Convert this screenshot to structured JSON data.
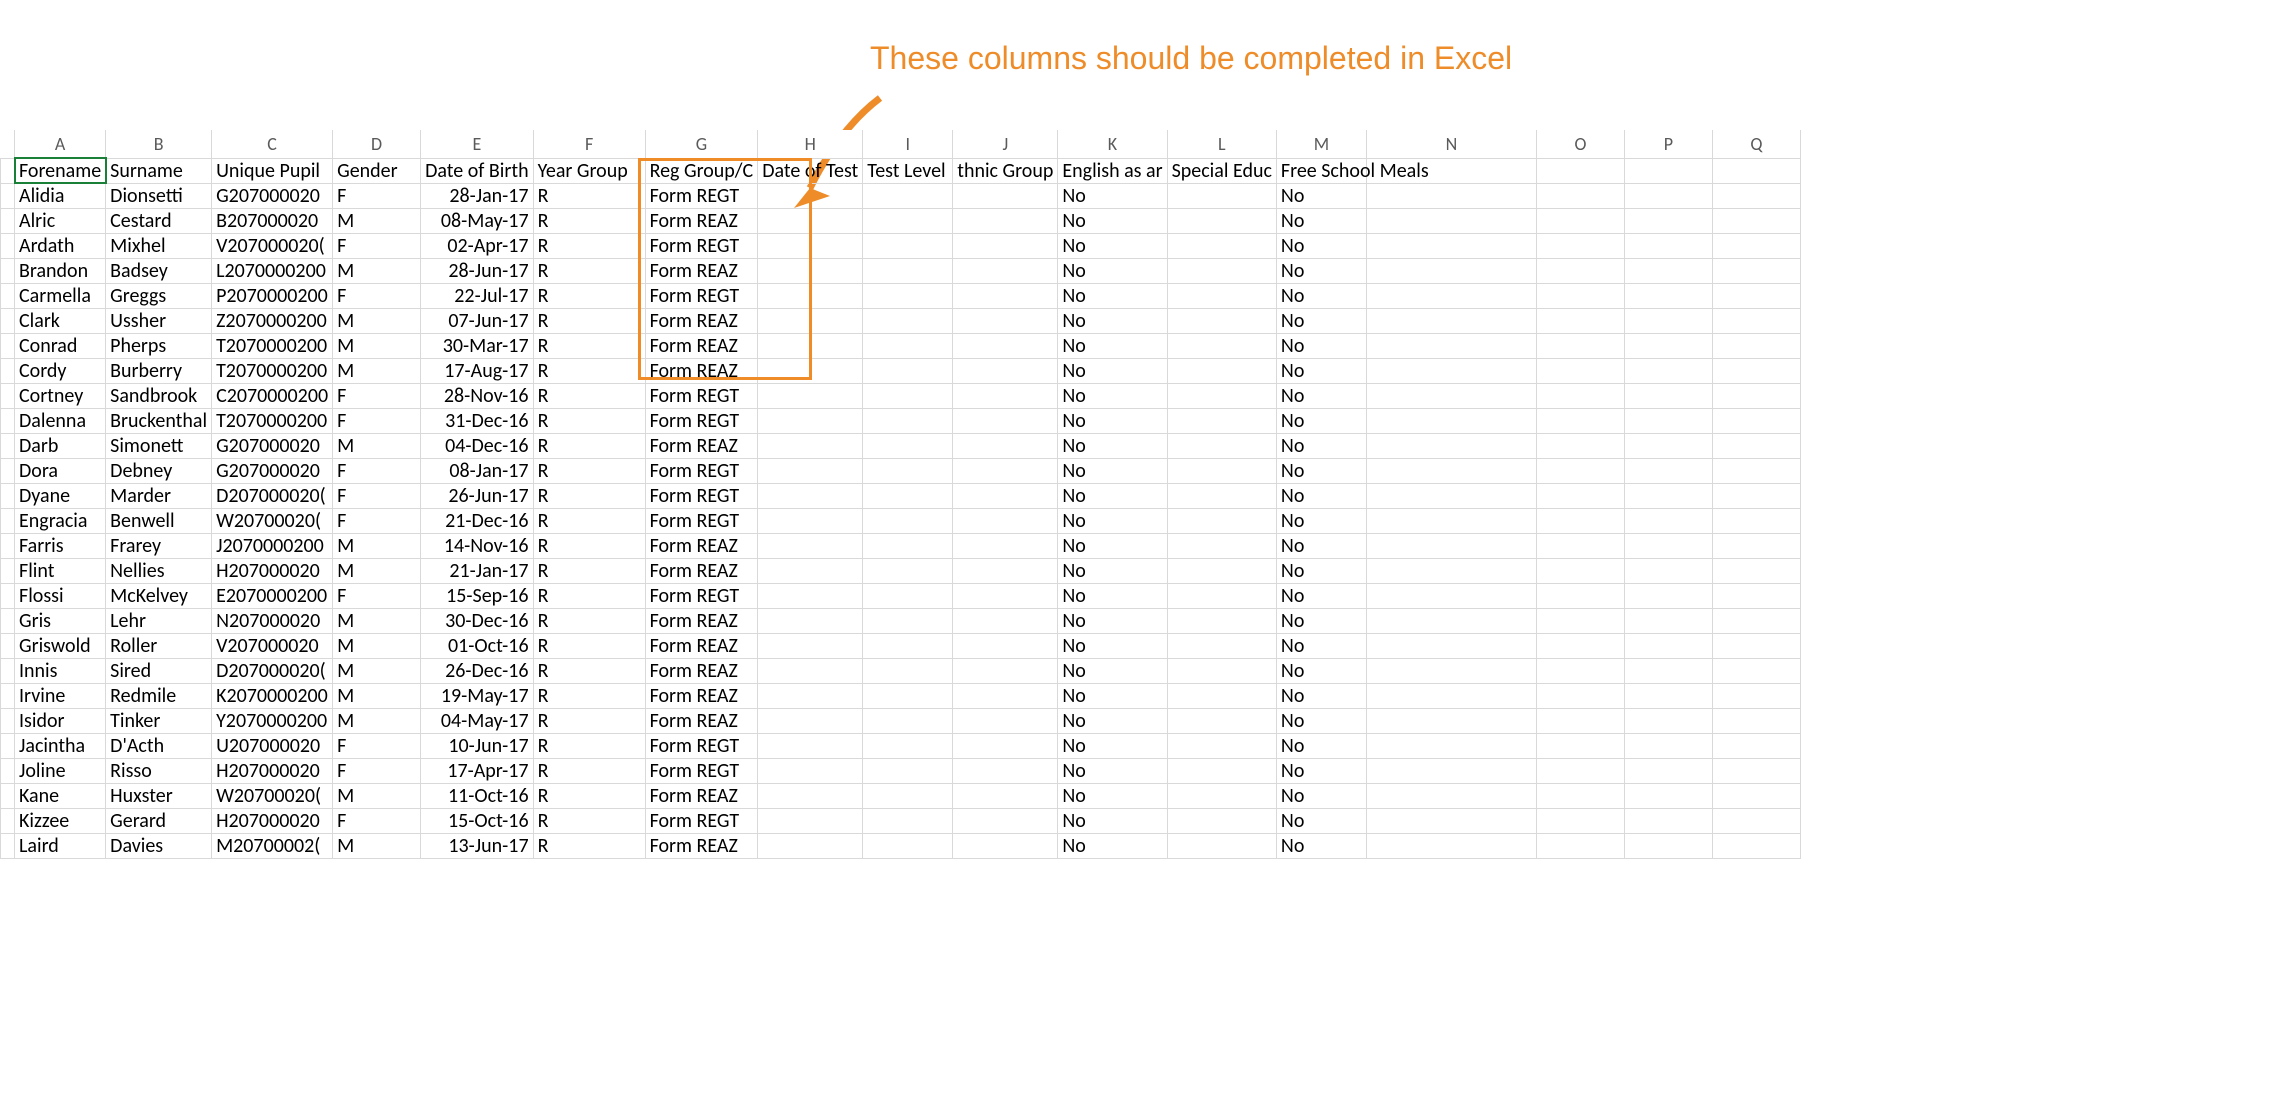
{
  "annotation": "These columns should be completed in Excel",
  "columns_letters": [
    "",
    "A",
    "B",
    "C",
    "D",
    "E",
    "F",
    "G",
    "H",
    "I",
    "J",
    "K",
    "L",
    "M",
    "N",
    "O",
    "P",
    "Q"
  ],
  "headers": [
    "Forename",
    "Surname",
    "Unique Pupil",
    "Gender",
    "Date of Birth",
    "Year Group",
    "Reg Group/C",
    "Date of Test",
    "Test Level",
    "thnic Group",
    "English as ar",
    "Special Educ",
    "Free School Meals"
  ],
  "rows": [
    {
      "forename": "Alidia",
      "surname": "Dionsetti",
      "upn": "G207000020",
      "gender": "F",
      "dob": "28-Jan-17",
      "yg": "R",
      "reg": "Form REGT",
      "eal": "No",
      "fsm": "No"
    },
    {
      "forename": "Alric",
      "surname": "Cestard",
      "upn": "B207000020",
      "gender": "M",
      "dob": "08-May-17",
      "yg": "R",
      "reg": "Form REAZ",
      "eal": "No",
      "fsm": "No"
    },
    {
      "forename": "Ardath",
      "surname": "Mixhel",
      "upn": "V207000020(",
      "gender": "F",
      "dob": "02-Apr-17",
      "yg": "R",
      "reg": "Form REGT",
      "eal": "No",
      "fsm": "No"
    },
    {
      "forename": "Brandon",
      "surname": "Badsey",
      "upn": "L2070000200",
      "gender": "M",
      "dob": "28-Jun-17",
      "yg": "R",
      "reg": "Form REAZ",
      "eal": "No",
      "fsm": "No"
    },
    {
      "forename": "Carmella",
      "surname": "Greggs",
      "upn": "P2070000200",
      "gender": "F",
      "dob": "22-Jul-17",
      "yg": "R",
      "reg": "Form REGT",
      "eal": "No",
      "fsm": "No"
    },
    {
      "forename": "Clark",
      "surname": "Ussher",
      "upn": "Z2070000200",
      "gender": "M",
      "dob": "07-Jun-17",
      "yg": "R",
      "reg": "Form REAZ",
      "eal": "No",
      "fsm": "No"
    },
    {
      "forename": "Conrad",
      "surname": "Pherps",
      "upn": "T2070000200",
      "gender": "M",
      "dob": "30-Mar-17",
      "yg": "R",
      "reg": "Form REAZ",
      "eal": "No",
      "fsm": "No"
    },
    {
      "forename": "Cordy",
      "surname": "Burberry",
      "upn": "T2070000200",
      "gender": "M",
      "dob": "17-Aug-17",
      "yg": "R",
      "reg": "Form REAZ",
      "eal": "No",
      "fsm": "No"
    },
    {
      "forename": "Cortney",
      "surname": "Sandbrook",
      "upn": "C2070000200",
      "gender": "F",
      "dob": "28-Nov-16",
      "yg": "R",
      "reg": "Form REGT",
      "eal": "No",
      "fsm": "No"
    },
    {
      "forename": "Dalenna",
      "surname": "Bruckenthal",
      "upn": "T2070000200",
      "gender": "F",
      "dob": "31-Dec-16",
      "yg": "R",
      "reg": "Form REGT",
      "eal": "No",
      "fsm": "No"
    },
    {
      "forename": "Darb",
      "surname": "Simonett",
      "upn": "G207000020",
      "gender": "M",
      "dob": "04-Dec-16",
      "yg": "R",
      "reg": "Form REAZ",
      "eal": "No",
      "fsm": "No"
    },
    {
      "forename": "Dora",
      "surname": "Debney",
      "upn": "G207000020",
      "gender": "F",
      "dob": "08-Jan-17",
      "yg": "R",
      "reg": "Form REGT",
      "eal": "No",
      "fsm": "No"
    },
    {
      "forename": "Dyane",
      "surname": "Marder",
      "upn": "D207000020(",
      "gender": "F",
      "dob": "26-Jun-17",
      "yg": "R",
      "reg": "Form REGT",
      "eal": "No",
      "fsm": "No"
    },
    {
      "forename": "Engracia",
      "surname": "Benwell",
      "upn": "W20700020(",
      "gender": "F",
      "dob": "21-Dec-16",
      "yg": "R",
      "reg": "Form REGT",
      "eal": "No",
      "fsm": "No"
    },
    {
      "forename": "Farris",
      "surname": "Frarey",
      "upn": "J2070000200",
      "gender": "M",
      "dob": "14-Nov-16",
      "yg": "R",
      "reg": "Form REAZ",
      "eal": "No",
      "fsm": "No"
    },
    {
      "forename": "Flint",
      "surname": "Nellies",
      "upn": "H207000020",
      "gender": "M",
      "dob": "21-Jan-17",
      "yg": "R",
      "reg": "Form REAZ",
      "eal": "No",
      "fsm": "No"
    },
    {
      "forename": "Flossi",
      "surname": "McKelvey",
      "upn": "E2070000200",
      "gender": "F",
      "dob": "15-Sep-16",
      "yg": "R",
      "reg": "Form REGT",
      "eal": "No",
      "fsm": "No"
    },
    {
      "forename": "Gris",
      "surname": "Lehr",
      "upn": "N207000020",
      "gender": "M",
      "dob": "30-Dec-16",
      "yg": "R",
      "reg": "Form REAZ",
      "eal": "No",
      "fsm": "No"
    },
    {
      "forename": "Griswold",
      "surname": "Roller",
      "upn": "V207000020",
      "gender": "M",
      "dob": "01-Oct-16",
      "yg": "R",
      "reg": "Form REAZ",
      "eal": "No",
      "fsm": "No"
    },
    {
      "forename": "Innis",
      "surname": "Sired",
      "upn": "D207000020(",
      "gender": "M",
      "dob": "26-Dec-16",
      "yg": "R",
      "reg": "Form REAZ",
      "eal": "No",
      "fsm": "No"
    },
    {
      "forename": "Irvine",
      "surname": "Redmile",
      "upn": "K2070000200",
      "gender": "M",
      "dob": "19-May-17",
      "yg": "R",
      "reg": "Form REAZ",
      "eal": "No",
      "fsm": "No"
    },
    {
      "forename": "Isidor",
      "surname": "Tinker",
      "upn": "Y2070000200",
      "gender": "M",
      "dob": "04-May-17",
      "yg": "R",
      "reg": "Form REAZ",
      "eal": "No",
      "fsm": "No"
    },
    {
      "forename": "Jacintha",
      "surname": "D'Acth",
      "upn": "U207000020",
      "gender": "F",
      "dob": "10-Jun-17",
      "yg": "R",
      "reg": "Form REGT",
      "eal": "No",
      "fsm": "No"
    },
    {
      "forename": "Joline",
      "surname": "Risso",
      "upn": "H207000020",
      "gender": "F",
      "dob": "17-Apr-17",
      "yg": "R",
      "reg": "Form REGT",
      "eal": "No",
      "fsm": "No"
    },
    {
      "forename": "Kane",
      "surname": "Huxster",
      "upn": "W20700020(",
      "gender": "M",
      "dob": "11-Oct-16",
      "yg": "R",
      "reg": "Form REAZ",
      "eal": "No",
      "fsm": "No"
    },
    {
      "forename": "Kizzee",
      "surname": "Gerard",
      "upn": "H207000020",
      "gender": "F",
      "dob": "15-Oct-16",
      "yg": "R",
      "reg": "Form REGT",
      "eal": "No",
      "fsm": "No"
    },
    {
      "forename": "Laird",
      "surname": "Davies",
      "upn": "M20700002(",
      "gender": "M",
      "dob": "13-Jun-17",
      "yg": "R",
      "reg": "Form REAZ",
      "eal": "No",
      "fsm": "No"
    }
  ]
}
